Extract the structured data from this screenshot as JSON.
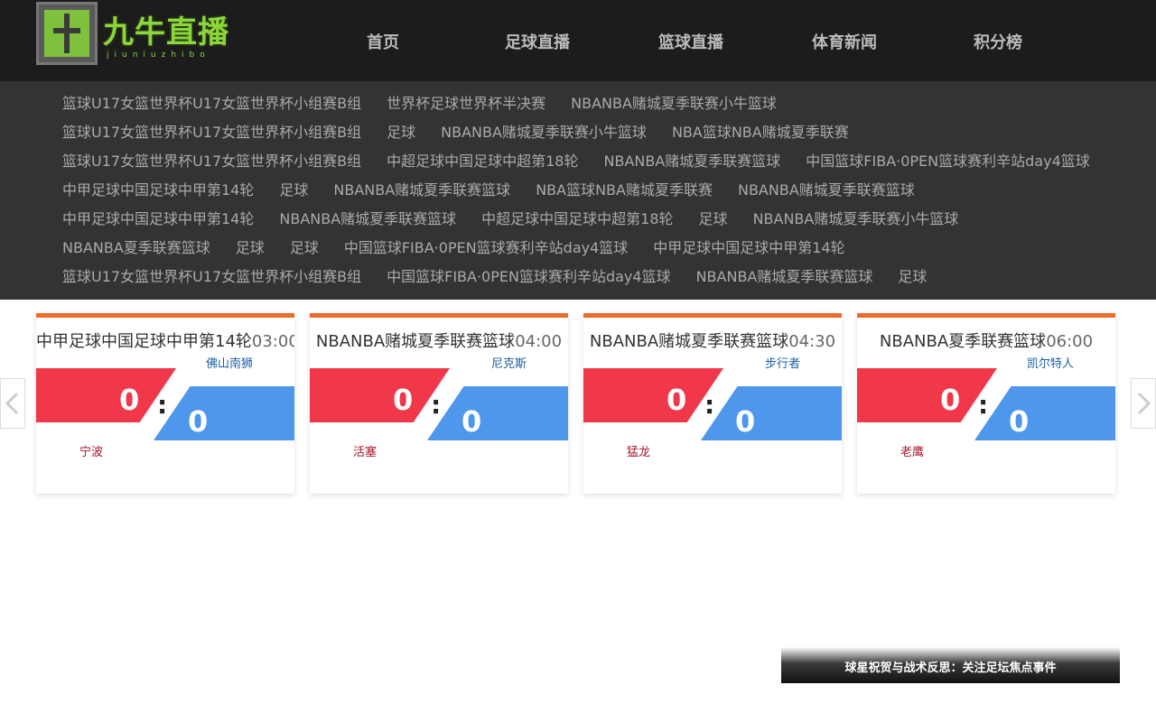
{
  "logo": {
    "text": "九牛直播",
    "sub": "jiuniuzhibo"
  },
  "nav": [
    "首页",
    "足球直播",
    "篮球直播",
    "体育新闻",
    "积分榜"
  ],
  "tag_rows": [
    [
      "篮球U17女篮世界杯U17女篮世界杯小组赛B组",
      "世界杯足球世界杯半决赛",
      "NBANBA赌城夏季联赛小牛篮球"
    ],
    [
      "篮球U17女篮世界杯U17女篮世界杯小组赛B组",
      "足球",
      "NBANBA赌城夏季联赛小牛篮球",
      "NBA篮球NBA赌城夏季联赛"
    ],
    [
      "篮球U17女篮世界杯U17女篮世界杯小组赛B组",
      "中超足球中国足球中超第18轮",
      "NBANBA赌城夏季联赛篮球",
      "中国篮球FIBA·0PEN篮球赛利辛站day4篮球"
    ],
    [
      "中甲足球中国足球中甲第14轮",
      "足球",
      "NBANBA赌城夏季联赛篮球",
      "NBA篮球NBA赌城夏季联赛",
      "NBANBA赌城夏季联赛篮球"
    ],
    [
      "中甲足球中国足球中甲第14轮",
      "NBANBA赌城夏季联赛篮球",
      "中超足球中国足球中超第18轮",
      "足球",
      "NBANBA赌城夏季联赛小牛篮球"
    ],
    [
      "NBANBA夏季联赛篮球",
      "足球",
      "足球",
      "中国篮球FIBA·0PEN篮球赛利辛站day4篮球",
      "中甲足球中国足球中甲第14轮"
    ],
    [
      "篮球U17女篮世界杯U17女篮世界杯小组赛B组",
      "中国篮球FIBA·0PEN篮球赛利辛站day4篮球",
      "NBANBA赌城夏季联赛篮球",
      "足球"
    ]
  ],
  "matches": [
    {
      "title": "中甲足球中国足球中甲第14轮",
      "time": "03:00",
      "home": "宁波",
      "away": "佛山南狮",
      "home_score": "0",
      "away_score": "0"
    },
    {
      "title": "NBANBA赌城夏季联赛篮球",
      "time": "04:00",
      "home": "活塞",
      "away": "尼克斯",
      "home_score": "0",
      "away_score": "0"
    },
    {
      "title": "NBANBA赌城夏季联赛篮球",
      "time": "04:30",
      "home": "猛龙",
      "away": "步行者",
      "home_score": "0",
      "away_score": "0"
    },
    {
      "title": "NBANBA夏季联赛篮球",
      "time": "06:00",
      "home": "老鹰",
      "away": "凯尔特人",
      "home_score": "0",
      "away_score": "0"
    }
  ],
  "score_separator": ":",
  "banner": {
    "text": "球星祝贺与战术反思：关注足坛焦点事件"
  },
  "colors": {
    "accent": "#ec6a2a",
    "home": "#f1384a",
    "away": "#4e97ec"
  }
}
